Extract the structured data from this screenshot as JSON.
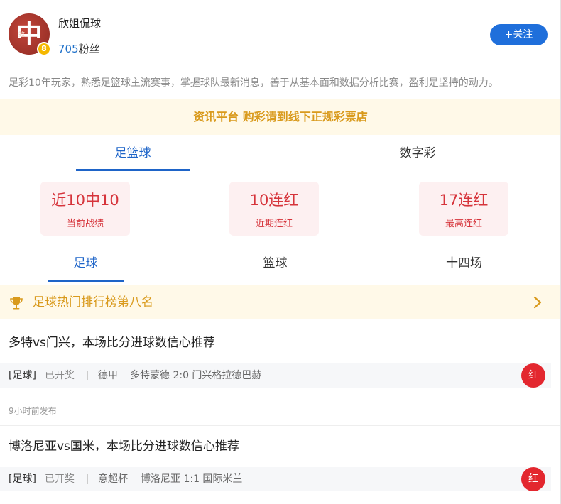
{
  "profile": {
    "avatar_char": "中",
    "avatar_sub": "数",
    "level": "8",
    "username": "欣姐侃球",
    "fans_count": "705",
    "fans_label": "粉丝",
    "follow_label": "+关注",
    "bio": "足彩10年玩家，熟悉足篮球主流赛事，掌握球队最新消息，善于从基本面和数据分析比赛，盈利是坚持的动力。"
  },
  "notice": "资讯平台 购彩请到线下正规彩票店",
  "main_tabs": [
    {
      "label": "足篮球",
      "active": true
    },
    {
      "label": "数字彩",
      "active": false
    }
  ],
  "stats": [
    {
      "value": "近10中10",
      "label": "当前战绩"
    },
    {
      "value": "10连红",
      "label": "近期连红"
    },
    {
      "value": "17连红",
      "label": "最高连红"
    }
  ],
  "sub_tabs": [
    {
      "label": "足球",
      "active": true
    },
    {
      "label": "篮球",
      "active": false
    },
    {
      "label": "十四场",
      "active": false
    }
  ],
  "rank": {
    "text": "足球热门排行榜第八名",
    "icon": "trophy-icon"
  },
  "articles": [
    {
      "title": "多特vs门兴，本场比分进球数信心推荐",
      "type": "[足球]",
      "status": "已开奖",
      "league": "德甲",
      "teams": "多特蒙德  2:0  门兴格拉德巴赫",
      "result": "红",
      "time": "9小时前发布"
    },
    {
      "title": "博洛尼亚vs国米，本场比分进球数信心推荐",
      "type": "[足球]",
      "status": "已开奖",
      "league": "意超杯",
      "teams": "博洛尼亚  1:1  国际米兰",
      "result": "红"
    }
  ],
  "colors": {
    "accent": "#1e64c8",
    "follow_button": "#1f6fdb",
    "gold": "#d99a1c",
    "notice_bg": "#fff9e8",
    "stat_red": "#d6343b",
    "stat_bg": "#fdf0f1",
    "badge_red": "#e3272f"
  }
}
